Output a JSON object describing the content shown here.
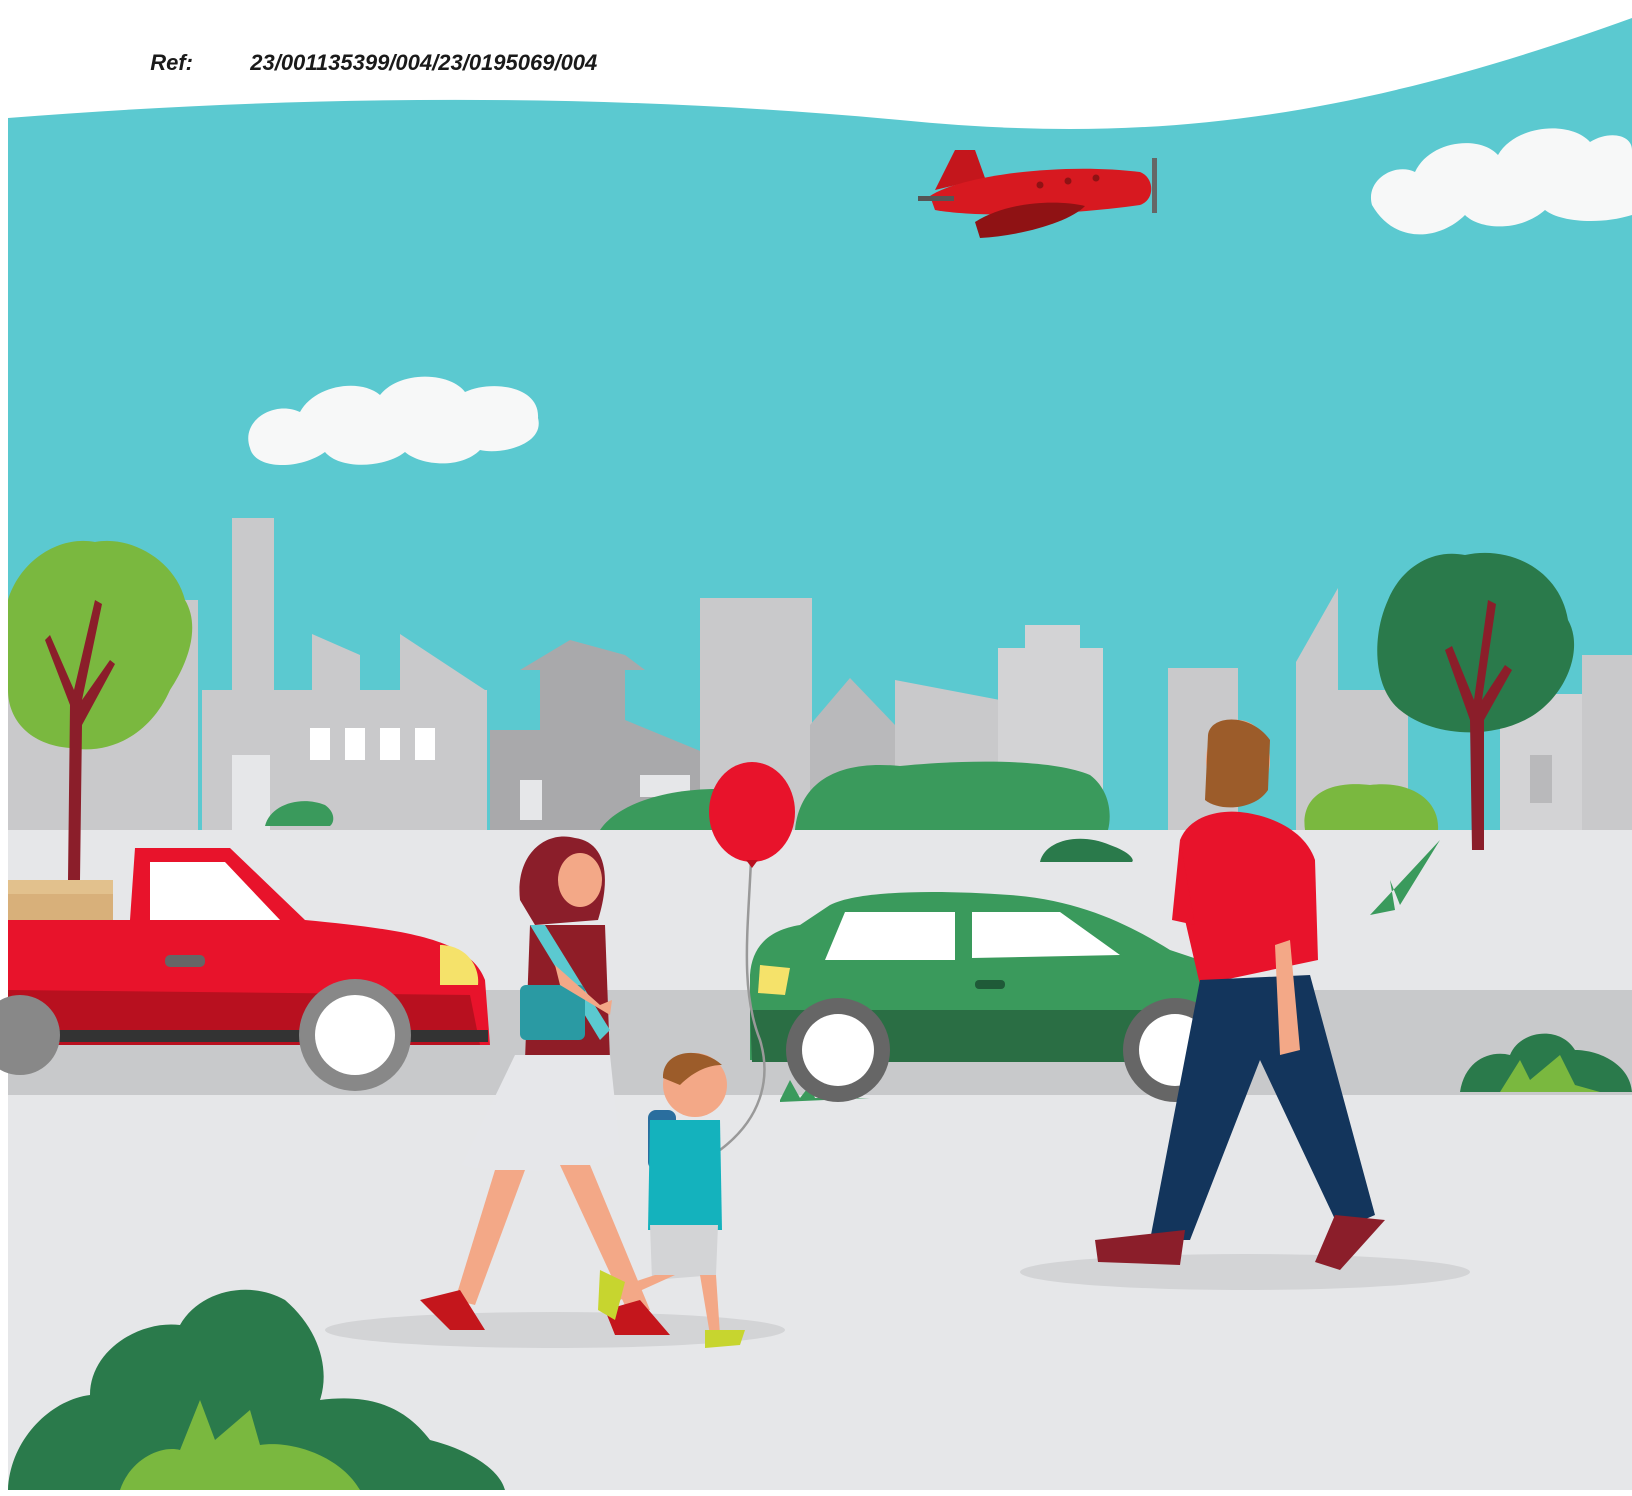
{
  "header": {
    "ref_label": "Ref:",
    "ref_value": "23/001135399/004/23/0195069/004"
  },
  "colors": {
    "sky": "#5bc9d0",
    "ground": "#e6e7e9",
    "road": "#c8c9cb",
    "building": "#c9c9cb",
    "building_dark": "#a9a9ab",
    "red": "#e8132b",
    "green_car": "#3a9a5c",
    "tree_light": "#7ab83f",
    "tree_dark": "#2a7a4b"
  },
  "scene": {
    "icons": [
      "plane-icon",
      "cloud-icon",
      "tree-icon",
      "car-icon",
      "balloon-icon",
      "person-icon",
      "bush-icon"
    ]
  }
}
